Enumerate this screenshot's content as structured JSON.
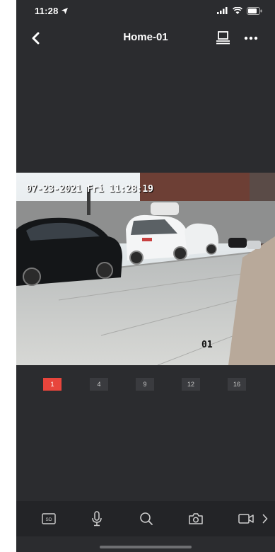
{
  "status_bar": {
    "time": "11:28"
  },
  "nav": {
    "title": "Home-01"
  },
  "video": {
    "timestamp": "07-23-2021 Fri 11:28:19",
    "channel": "01"
  },
  "layout_options": [
    {
      "label": "1",
      "active": true
    },
    {
      "label": "4",
      "active": false
    },
    {
      "label": "9",
      "active": false
    },
    {
      "label": "12",
      "active": false
    },
    {
      "label": "16",
      "active": false
    }
  ],
  "toolbar": {
    "quality_label": "SD",
    "icons": [
      "sd-quality-icon",
      "microphone-icon",
      "search-icon",
      "camera-icon",
      "video-record-icon",
      "chevron-right-icon"
    ]
  },
  "colors": {
    "accent": "#e8453c",
    "background": "#2b2c2f",
    "toolbar": "#232427"
  }
}
